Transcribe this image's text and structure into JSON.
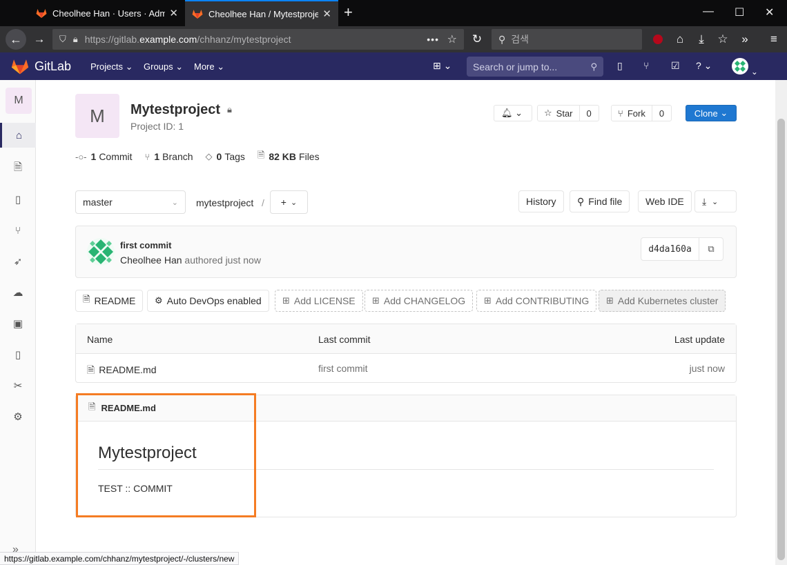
{
  "browser": {
    "tabs": [
      {
        "title": "Cheolhee Han · Users · Admin",
        "active": false
      },
      {
        "title": "Cheolhee Han / Mytestproject",
        "active": true
      }
    ],
    "url_prefix": "https://gitlab.",
    "url_host": "example.com",
    "url_path": "/chhanz/mytestproject",
    "search_placeholder": "검색",
    "status_url": "https://gitlab.example.com/chhanz/mytestproject/-/clusters/new"
  },
  "gitlab_header": {
    "brand": "GitLab",
    "menus": [
      "Projects",
      "Groups",
      "More"
    ],
    "search_placeholder": "Search or jump to..."
  },
  "sidebar": {
    "project_initial": "M",
    "items": [
      "home-icon",
      "repository-icon",
      "issues-icon",
      "merge-requests-icon",
      "ci-cd-icon",
      "operations-icon",
      "packages-icon",
      "wiki-icon",
      "snippets-icon",
      "settings-icon"
    ]
  },
  "project": {
    "initial": "M",
    "name": "Mytestproject",
    "id_label": "Project ID: 1",
    "star_label": "Star",
    "star_count": "0",
    "fork_label": "Fork",
    "fork_count": "0",
    "clone_label": "Clone",
    "stats": {
      "commits_num": "1",
      "commits_label": "Commit",
      "branches_num": "1",
      "branches_label": "Branch",
      "tags_num": "0",
      "tags_label": "Tags",
      "files_num": "82 KB",
      "files_label": "Files"
    }
  },
  "tree": {
    "branch": "master",
    "path": "mytestproject",
    "separator": "/",
    "history": "History",
    "find_file": "Find file",
    "web_ide": "Web IDE"
  },
  "last_commit": {
    "title": "first commit",
    "author": "Cheolhee Han",
    "meta": "authored just now",
    "sha": "d4da160a"
  },
  "quick_buttons": {
    "readme": "README",
    "autodevops": "Auto DevOps enabled",
    "license": "Add LICENSE",
    "changelog": "Add CHANGELOG",
    "contributing": "Add CONTRIBUTING",
    "kubernetes": "Add Kubernetes cluster"
  },
  "file_table": {
    "headers": {
      "name": "Name",
      "last_commit": "Last commit",
      "last_update": "Last update"
    },
    "rows": [
      {
        "name": "README.md",
        "last_commit": "first commit",
        "last_update": "just now"
      }
    ]
  },
  "readme": {
    "filename": "README.md",
    "heading": "Mytestproject",
    "body": "TEST :: COMMIT"
  },
  "colors": {
    "header_bg": "#292961",
    "clone_blue": "#1f78d1",
    "highlight_orange": "#f57c23"
  }
}
